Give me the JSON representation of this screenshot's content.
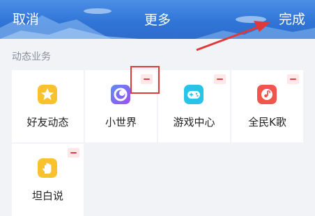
{
  "header": {
    "cancel_label": "取消",
    "title": "更多",
    "done_label": "完成",
    "background_color": "#3a7de0"
  },
  "section": {
    "title": "动态业务"
  },
  "items": [
    {
      "label": "好友动态",
      "icon": "friends-feed-star-icon",
      "icon_color": "#f7c22d"
    },
    {
      "label": "小世界",
      "icon": "small-world-planet-icon",
      "icon_color": "#7b5bf0"
    },
    {
      "label": "游戏中心",
      "icon": "game-controller-icon",
      "icon_color": "#29c3e8"
    },
    {
      "label": "全民K歌",
      "icon": "karaoke-music-icon",
      "icon_color": "#f0564e"
    },
    {
      "label": "坦白说",
      "icon": "hand-icon",
      "icon_color": "#f7c22d"
    }
  ],
  "annotation": {
    "highlight_color": "#e13838"
  }
}
